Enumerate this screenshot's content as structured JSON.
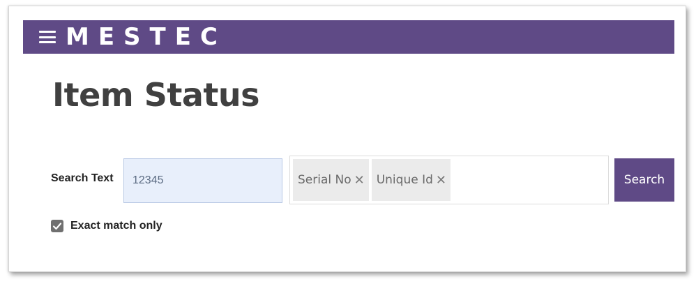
{
  "header": {
    "menu_icon": "hamburger-menu-icon",
    "logo_text": "MESTEC",
    "background_color": "#5f4a86"
  },
  "page": {
    "title": "Item Status"
  },
  "search": {
    "label": "Search Text",
    "value": "12345",
    "fields": [
      {
        "label": "Serial No",
        "remove_icon": "close-icon"
      },
      {
        "label": "Unique Id",
        "remove_icon": "close-icon"
      }
    ],
    "button_label": "Search",
    "button_color": "#5f4a86"
  },
  "options": {
    "exact_match_label": "Exact match only",
    "exact_match_checked": true
  }
}
